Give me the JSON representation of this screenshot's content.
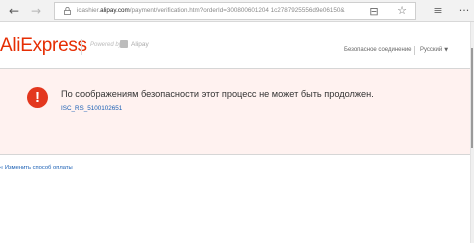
{
  "browser": {
    "back_glyph": "←",
    "forward_glyph": "→",
    "url_domain_prefix": "icashier.",
    "url_domain": "alipay.com",
    "url_path": "/payment/verification.htm?orderId=300800601204 1c2787925556d9e06150&",
    "reader_glyph": "⊟",
    "star_glyph": "☆",
    "hub_glyph": "≡",
    "more_glyph": "···",
    "icons": [
      "back-icon",
      "forward-icon",
      "lock-icon",
      "reader-view-icon",
      "favorite-star-icon",
      "hub-icon",
      "more-icon"
    ]
  },
  "header": {
    "logo": "AliExpress",
    "powered_by": "Powered by",
    "alipay": "Alipay",
    "secure_connection": "Безопасное соединение",
    "language": "Русский",
    "caret": "▼"
  },
  "error": {
    "icon_glyph": "!",
    "message": "По соображениям безопасности этот процесс не может быть продолжен.",
    "code": "ISC_RS_5100102651",
    "color": "#e3371e",
    "background": "#fff2f0"
  },
  "footer": {
    "change_payment": "« Изменить способ оплаты"
  },
  "colors": {
    "brand": "#e62e04",
    "link": "#1a5fb4"
  }
}
